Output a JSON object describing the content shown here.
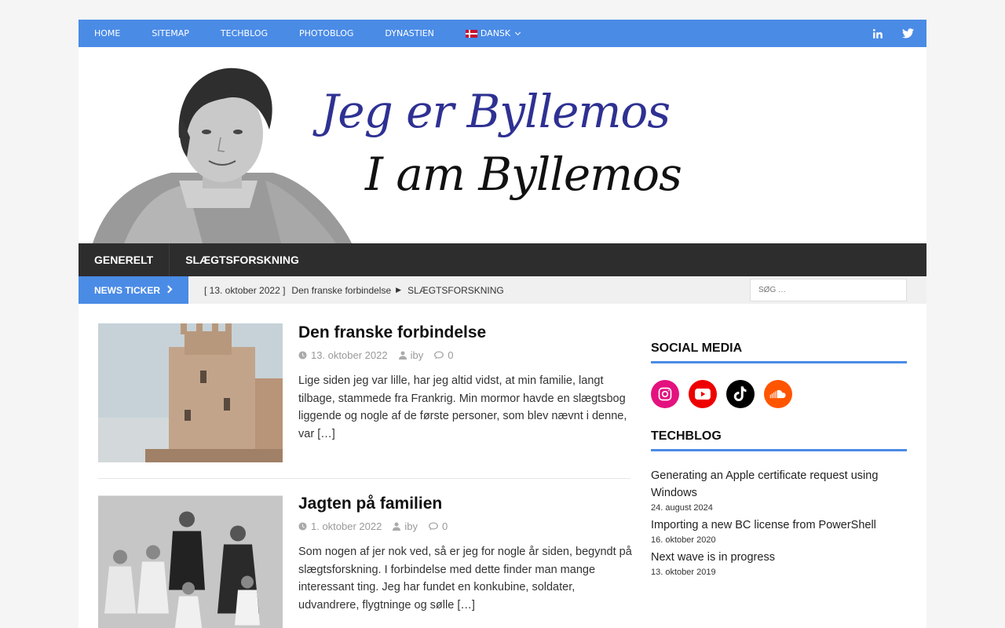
{
  "topnav": {
    "items": [
      "HOME",
      "SITEMAP",
      "TECHBLOG",
      "PHOTOBLOG",
      "DYNASTIEN"
    ],
    "language": "DANSK"
  },
  "header": {
    "title_da": "Jeg er Byllemos",
    "title_en": "I am Byllemos"
  },
  "mainnav": {
    "items": [
      "GENERELT",
      "SLÆGTSFORSKNING"
    ]
  },
  "ticker": {
    "label": "NEWS TICKER",
    "date": "[ 13. oktober 2022 ]",
    "title": "Den franske forbindelse",
    "category": "SLÆGTSFORSKNING"
  },
  "search": {
    "placeholder": "SØG …"
  },
  "posts": [
    {
      "title": "Den franske forbindelse",
      "date": "13. oktober 2022",
      "author": "iby",
      "comments": "0",
      "excerpt": "Lige siden jeg var lille, har jeg altid vidst, at min familie, langt tilbage, stammede fra Frankrig. Min mormor havde en slægtsbog liggende og nogle af de første personer, som blev nævnt i denne, var",
      "more": "[…]"
    },
    {
      "title": "Jagten på familien",
      "date": "1. oktober 2022",
      "author": "iby",
      "comments": "0",
      "excerpt": "Som nogen af jer nok ved, så er jeg for nogle år siden, begyndt på slægtsforskning. I forbindelse med dette finder man mange interessant ting. Jeg har fundet en konkubine, soldater, udvandrere, flygtninge og sølle",
      "more": "[…]"
    }
  ],
  "sidebar": {
    "social_title": "SOCIAL MEDIA",
    "techblog_title": "TECHBLOG",
    "social_icons": [
      {
        "icon": "instagram-icon",
        "color": "#e4127f"
      },
      {
        "icon": "youtube-icon",
        "color": "#ee0000"
      },
      {
        "icon": "tiktok-icon",
        "color": "#000000"
      },
      {
        "icon": "soundcloud-icon",
        "color": "#ff5500"
      }
    ],
    "techblog": [
      {
        "title": "Generating an Apple certificate request using Windows",
        "date": "24. august 2024"
      },
      {
        "title": "Importing a new BC license from PowerShell",
        "date": "16. oktober 2020"
      },
      {
        "title": "Next wave is in progress",
        "date": "13. oktober 2019"
      }
    ]
  },
  "colors": {
    "accent": "#4a8be6",
    "nav_dark": "#2d2d2d",
    "title_blue": "#2e3192"
  }
}
